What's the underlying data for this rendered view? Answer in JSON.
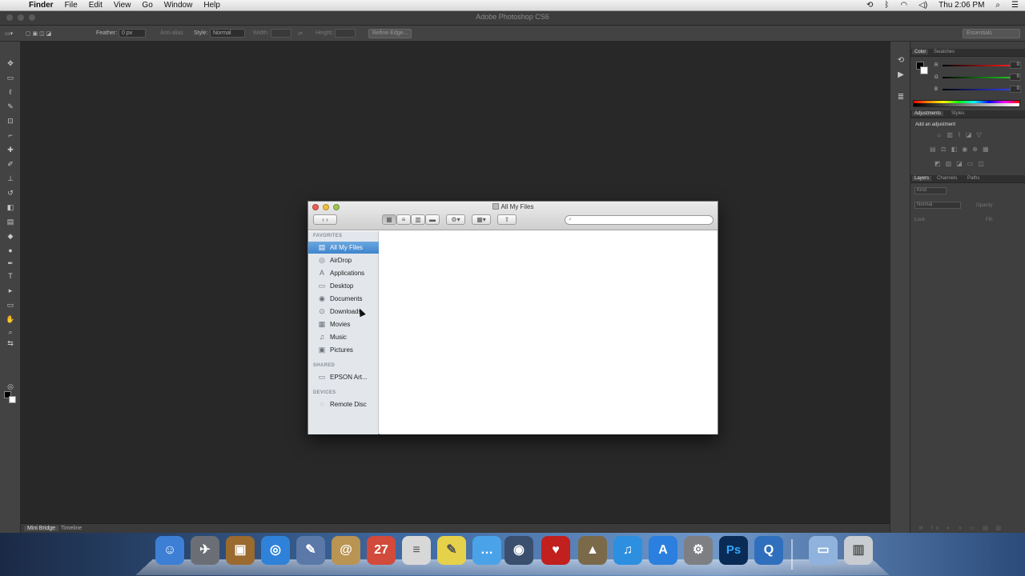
{
  "menubar": {
    "apple_icon": "apple-logo-icon",
    "menus": [
      "Finder",
      "File",
      "Edit",
      "View",
      "Go",
      "Window",
      "Help"
    ],
    "clock": "Thu 2:06 PM"
  },
  "photoshop": {
    "window_title": "Adobe Photoshop CS6",
    "options": {
      "feather_label": "Feather:",
      "feather_value": "0 px",
      "anti_alias": "Anti-alias",
      "style_label": "Style:",
      "style_value": "Normal",
      "width_label": "Width:",
      "height_label": "Height:",
      "refine_edge": "Refine Edge...",
      "workspace": "Essentials"
    },
    "statusbar": {
      "tab_active": "Mini Bridge",
      "tab_2": "Timeline"
    },
    "panels": {
      "color_tabs": [
        "Color",
        "Swatches"
      ],
      "rgb": [
        {
          "label": "R",
          "value": "0"
        },
        {
          "label": "G",
          "value": "0"
        },
        {
          "label": "B",
          "value": "0"
        }
      ],
      "adjust_tabs": [
        "Adjustments",
        "Styles"
      ],
      "adjust_heading": "Add an adjustment",
      "layers_tabs": [
        "Layers",
        "Channels",
        "Paths"
      ],
      "layers_kind": "Kind",
      "layers_blend": "Normal",
      "layers_opacity": "Opacity:",
      "layers_lock": "Lock:",
      "layers_fill": "Fill:"
    }
  },
  "finder": {
    "title": "All My Files",
    "search_placeholder": "",
    "sections": {
      "favorites": "FAVORITES",
      "shared": "SHARED",
      "devices": "DEVICES"
    },
    "favorites": [
      {
        "label": "All My Files",
        "icon": "all-files-icon",
        "glyph": "▤"
      },
      {
        "label": "AirDrop",
        "icon": "airdrop-icon",
        "glyph": "◎"
      },
      {
        "label": "Applications",
        "icon": "applications-icon",
        "glyph": "A"
      },
      {
        "label": "Desktop",
        "icon": "desktop-icon",
        "glyph": "▭"
      },
      {
        "label": "Documents",
        "icon": "documents-icon",
        "glyph": "◉"
      },
      {
        "label": "Downloads",
        "icon": "downloads-icon",
        "glyph": "⊙"
      },
      {
        "label": "Movies",
        "icon": "movies-icon",
        "glyph": "▦"
      },
      {
        "label": "Music",
        "icon": "music-icon",
        "glyph": "♫"
      },
      {
        "label": "Pictures",
        "icon": "pictures-icon",
        "glyph": "▣"
      }
    ],
    "shared": [
      {
        "label": "EPSON Art...",
        "icon": "printer-share-icon",
        "glyph": "▭"
      }
    ],
    "devices": [
      {
        "label": "Remote Disc",
        "icon": "remote-disc-icon",
        "glyph": "◌"
      }
    ]
  },
  "dock": {
    "apps": [
      {
        "name": "finder",
        "glyph": "☺",
        "color": "#3d7fd4"
      },
      {
        "name": "launchpad",
        "glyph": "✈",
        "color": "#6b6f75"
      },
      {
        "name": "photo-booth",
        "glyph": "▣",
        "color": "#9a6a2e"
      },
      {
        "name": "safari",
        "glyph": "◎",
        "color": "#2f82d8"
      },
      {
        "name": "preview",
        "glyph": "✎",
        "color": "#5a78a8"
      },
      {
        "name": "contacts",
        "glyph": "@",
        "color": "#b99452"
      },
      {
        "name": "calendar",
        "glyph": "27",
        "color": "#d24a3b"
      },
      {
        "name": "textedit",
        "glyph": "≡",
        "color": "#d8d8d8"
      },
      {
        "name": "stickies",
        "glyph": "✎",
        "color": "#e6d24a"
      },
      {
        "name": "messages",
        "glyph": "…",
        "color": "#4aa3e8"
      },
      {
        "name": "facetime",
        "glyph": "◉",
        "color": "#3a4f6e"
      },
      {
        "name": "photo-book",
        "glyph": "♥",
        "color": "#c21f1f"
      },
      {
        "name": "iphoto",
        "glyph": "▲",
        "color": "#7a6a4a"
      },
      {
        "name": "itunes",
        "glyph": "♫",
        "color": "#2d8fe0"
      },
      {
        "name": "app-store",
        "glyph": "A",
        "color": "#2b7fde"
      },
      {
        "name": "system-preferences",
        "glyph": "⚙",
        "color": "#7d7f83"
      },
      {
        "name": "photoshop",
        "glyph": "Ps",
        "color": "#0a2b55"
      },
      {
        "name": "quicktime",
        "glyph": "Q",
        "color": "#2f6fbd"
      },
      {
        "name": "downloads-stack",
        "glyph": "▭",
        "color": "#8fb3dc"
      },
      {
        "name": "trash",
        "glyph": "▥",
        "color": "#c9ccd1"
      }
    ]
  }
}
